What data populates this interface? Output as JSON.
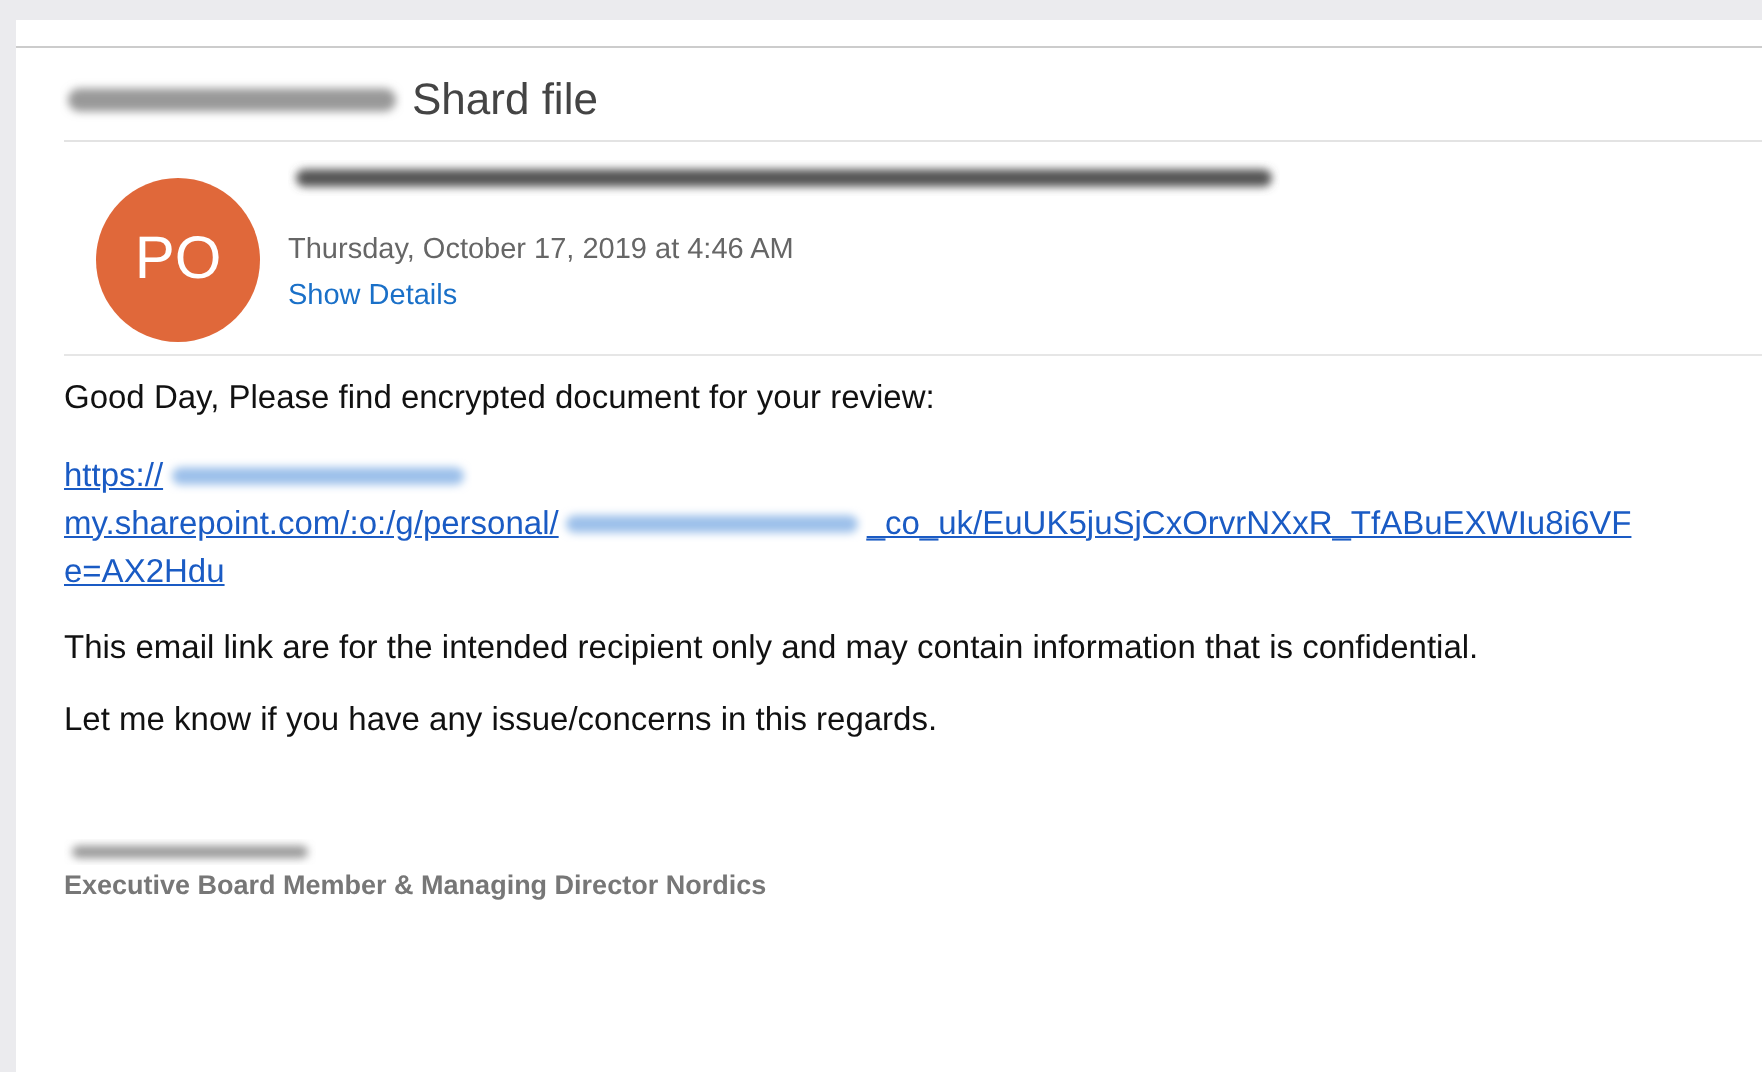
{
  "subject": {
    "parts": [
      {
        "kind": "redacted"
      },
      {
        "kind": "text",
        "text": "Shard file"
      }
    ]
  },
  "sender": {
    "initials": "PO",
    "color": "#e0683a",
    "name": {
      "kind": "redacted"
    },
    "date": "Thursday, October 17, 2019 at 4:46 AM",
    "details_link": "Show Details"
  },
  "body": {
    "greeting": "Good Day, Please find encrypted document for your review:",
    "link_lines": [
      [
        {
          "kind": "link",
          "text": "https://"
        },
        {
          "kind": "redacted"
        }
      ],
      [
        {
          "kind": "link",
          "text": "my.sharepoint.com/:o:/g/personal/"
        },
        {
          "kind": "redacted"
        },
        {
          "kind": "link",
          "text": "_co_uk/EuUK5juSjCxOrvrNXxR_TfABuEXWIu8i6VF"
        }
      ],
      [
        {
          "kind": "link",
          "text": "e=AX2Hdu"
        }
      ]
    ],
    "paragraphs": [
      "This email link are for the intended recipient only and may contain information that is confidential.",
      "Let me know if you have any issue/concerns in this regards."
    ]
  },
  "signature": {
    "name": {
      "kind": "redacted"
    },
    "title": "Executive Board Member & Managing Director Nordics"
  }
}
